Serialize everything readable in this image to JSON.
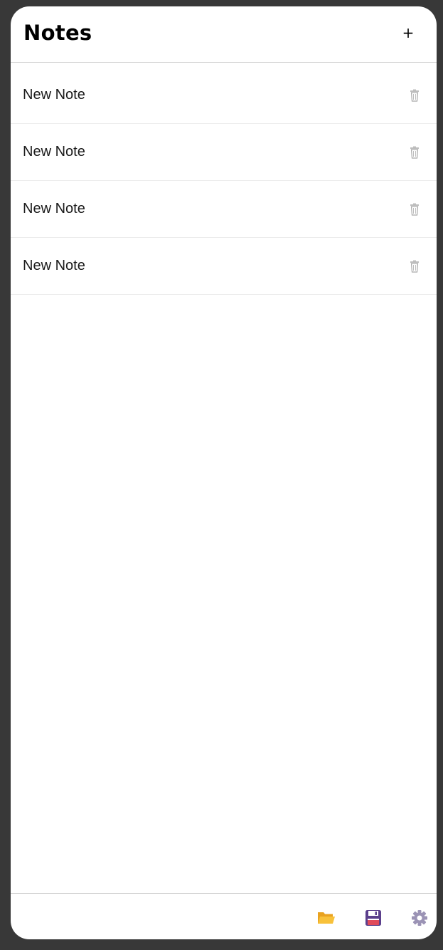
{
  "header": {
    "title": "Notes",
    "add_label": "+"
  },
  "notes": [
    {
      "title": "New Note"
    },
    {
      "title": "New Note"
    },
    {
      "title": "New Note"
    },
    {
      "title": "New Note"
    }
  ],
  "icons": {
    "add": "plus-icon",
    "delete": "trash-icon",
    "open": "folder-icon",
    "save": "floppy-disk-icon",
    "settings": "gear-icon"
  },
  "colors": {
    "background": "#383838",
    "folder": "#f5b92f",
    "save": "#5b3f8c",
    "gear": "#9b93b5"
  }
}
